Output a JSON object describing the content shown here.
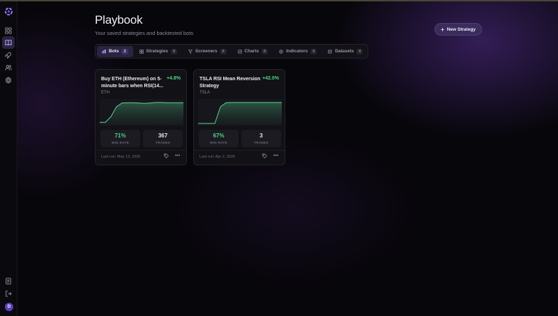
{
  "header": {
    "title": "Playbook",
    "subtitle": "Your saved strategies and backtested bots",
    "new_button_label": "New Strategy"
  },
  "sidebar": {
    "items": [
      {
        "icon": "dashboard-icon",
        "active": false
      },
      {
        "icon": "book-icon",
        "active": true
      },
      {
        "icon": "rocket-icon",
        "active": false
      },
      {
        "icon": "users-icon",
        "active": false
      },
      {
        "icon": "gear-icon",
        "active": false
      }
    ],
    "bottom": [
      {
        "icon": "document-icon"
      },
      {
        "icon": "logout-icon"
      }
    ],
    "avatar_initial": "D"
  },
  "tabs": [
    {
      "label": "Bots",
      "count": "2",
      "icon": "bot-icon",
      "active": true
    },
    {
      "label": "Strategies",
      "count": "0",
      "icon": "grid-icon",
      "active": false
    },
    {
      "label": "Screeners",
      "count": "0",
      "icon": "filter-icon",
      "active": false
    },
    {
      "label": "Charts",
      "count": "0",
      "icon": "chart-icon",
      "active": false
    },
    {
      "label": "Indicators",
      "count": "0",
      "icon": "target-icon",
      "active": false
    },
    {
      "label": "Datasets",
      "count": "0",
      "icon": "database-icon",
      "active": false
    }
  ],
  "cards": [
    {
      "title": "Buy ETH (Ethereum) on 5-minute bars when RSI(14...",
      "return": "+4.8%",
      "ticker": "ETH",
      "win_rate": "71%",
      "win_rate_label": "WIN RATE",
      "trades": "367",
      "trades_label": "TRADES",
      "last_run": "Last run: May 13, 2026",
      "equity_curve": [
        0.05,
        0.05,
        0.3,
        0.75,
        0.92,
        0.93,
        0.93,
        0.92,
        0.9,
        0.92,
        0.94,
        0.94,
        0.93,
        0.93,
        0.93,
        0.93
      ]
    },
    {
      "title": "TSLA RSI Mean Reversion Strategy",
      "return": "+42.0%",
      "ticker": "TSLA",
      "win_rate": "67%",
      "win_rate_label": "WIN RATE",
      "trades": "3",
      "trades_label": "TRADES",
      "last_run": "Last run: Apr 2, 2026",
      "equity_curve": [
        0.0,
        0.0,
        0.0,
        0.0,
        0.75,
        0.93,
        0.94,
        0.94,
        0.94,
        0.94,
        0.94,
        0.94,
        0.94,
        0.94,
        0.94,
        0.94
      ]
    }
  ],
  "colors": {
    "accent": "#5b3fbf",
    "positive": "#4fd38a",
    "curve": "#5fcf8f"
  }
}
